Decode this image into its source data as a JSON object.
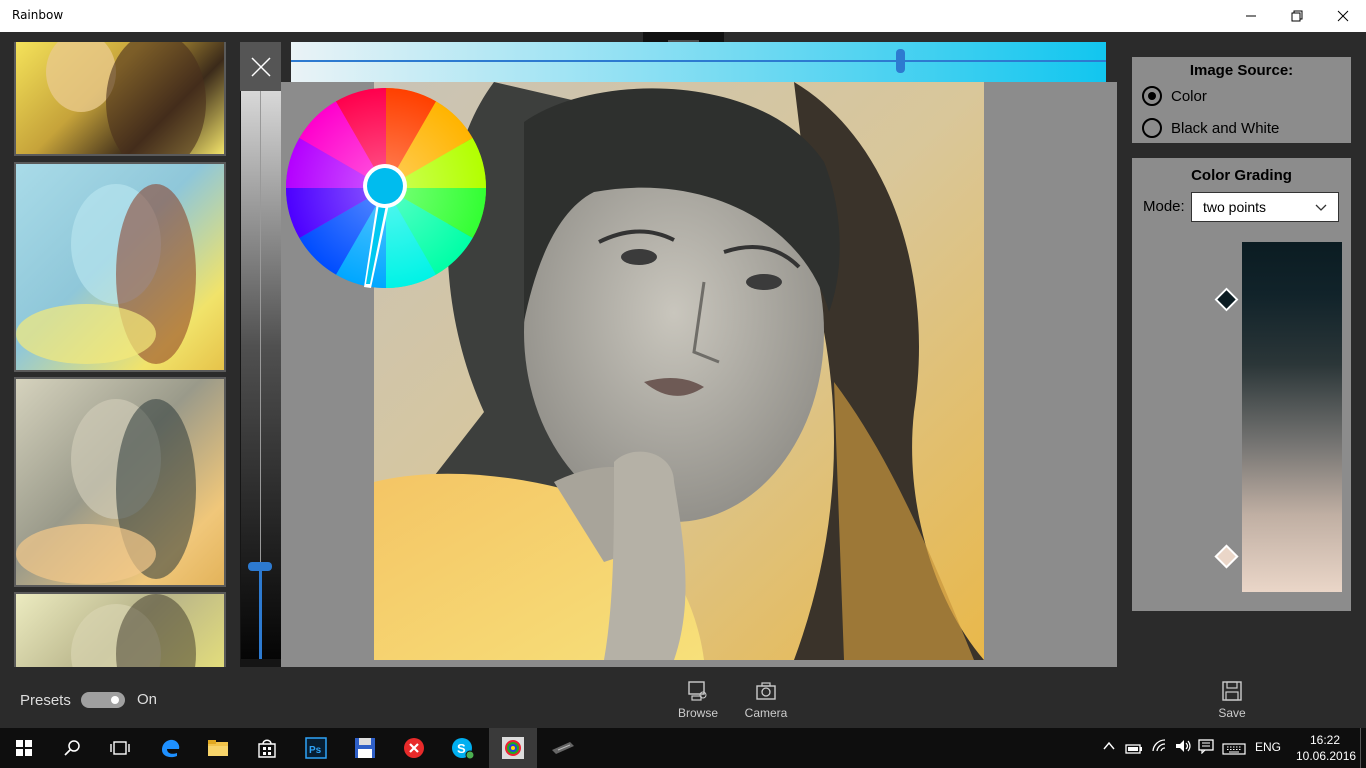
{
  "window": {
    "title": "Rainbow",
    "minimize_icon": "minimize-icon",
    "maximize_icon": "restore-icon",
    "close_icon": "close-icon"
  },
  "presets": {
    "label": "Presets",
    "toggle_state": "On",
    "enabled": true
  },
  "image_source": {
    "title": "Image Source:",
    "options": [
      "Color",
      "Black and White"
    ],
    "selected": "Color"
  },
  "color_grading": {
    "title": "Color Grading",
    "mode_label": "Mode:",
    "mode_value": "two points",
    "point_colors": [
      "#0b1c22",
      "#ead6c8"
    ]
  },
  "commands": {
    "browse": "Browse",
    "camera": "Camera",
    "save": "Save"
  },
  "taskbar": {
    "apps": [
      "windows-start-icon",
      "search-icon",
      "task-view-icon",
      "edge-icon",
      "file-explorer-icon",
      "store-icon",
      "photoshop-icon",
      "save-disk-icon",
      "close-app-icon",
      "skype-icon",
      "rainbow-app-icon",
      "pen-tablet-icon"
    ],
    "language": "ENG",
    "time": "16:22",
    "date": "10.06.2016"
  },
  "colors": {
    "hue_slider_end": "#12c6ef",
    "selected_hue": "#00bcee",
    "accent": "#2d7ad0"
  }
}
